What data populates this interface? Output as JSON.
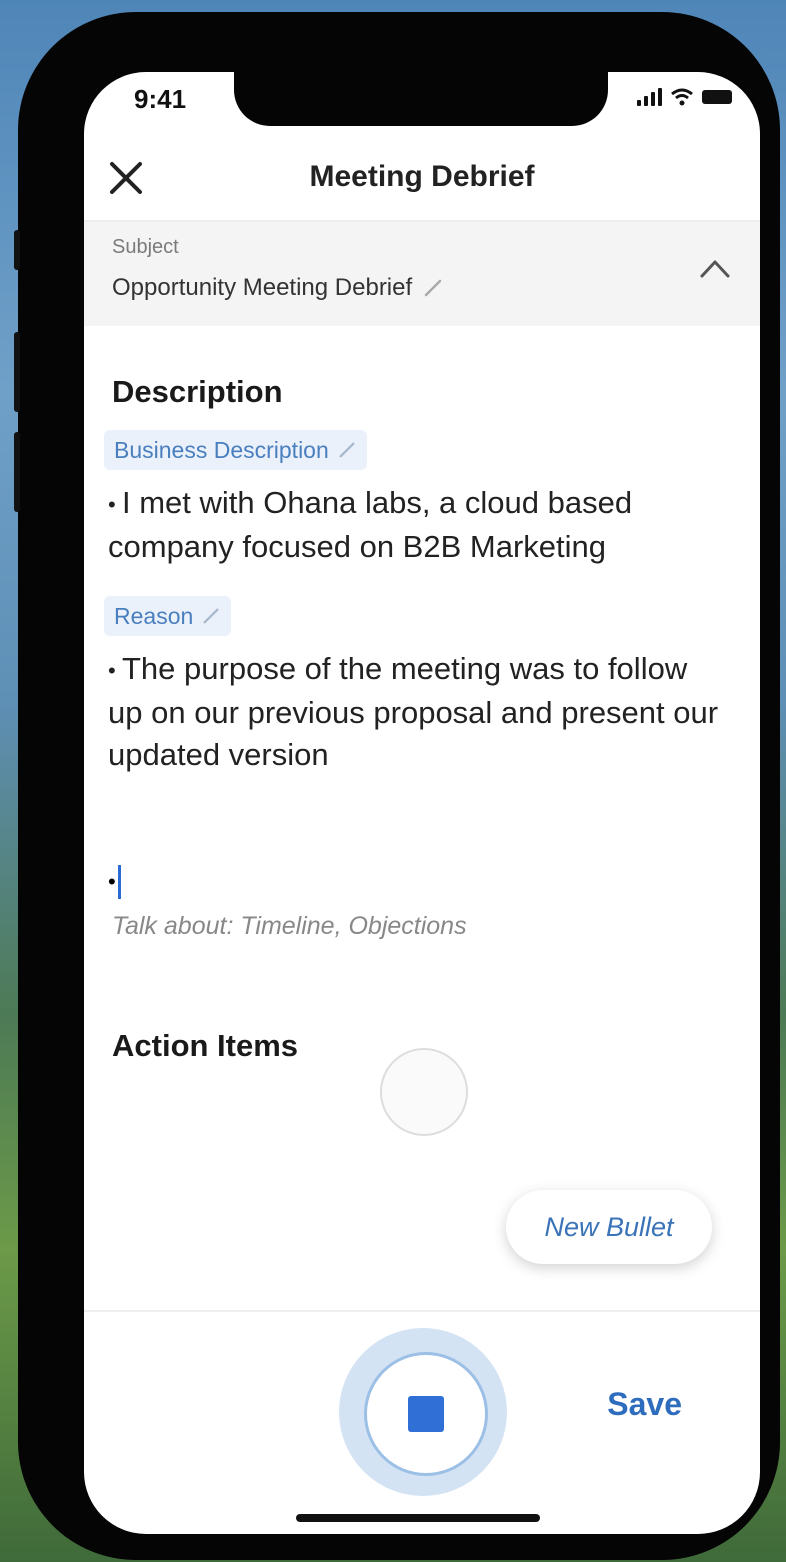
{
  "status_bar": {
    "time": "9:41"
  },
  "header": {
    "title": "Meeting Debrief"
  },
  "subject": {
    "label": "Subject",
    "value": "Opportunity Meeting Debrief"
  },
  "description": {
    "title": "Description",
    "sections": [
      {
        "tag": "Business Description",
        "bullet": "I met with Ohana labs, a cloud based company focused on B2B Marketing"
      },
      {
        "tag": "Reason",
        "bullet": "The purpose of the meeting was to follow up on our previous proposal and present our updated version"
      }
    ],
    "hint": "Talk about: Timeline, Objections"
  },
  "action_items": {
    "title": "Action Items"
  },
  "buttons": {
    "new_bullet": "New Bullet",
    "save": "Save"
  },
  "colors": {
    "accent": "#2e6dbd",
    "chip_bg": "#eaf1fa",
    "record": "#2f6fd6"
  }
}
